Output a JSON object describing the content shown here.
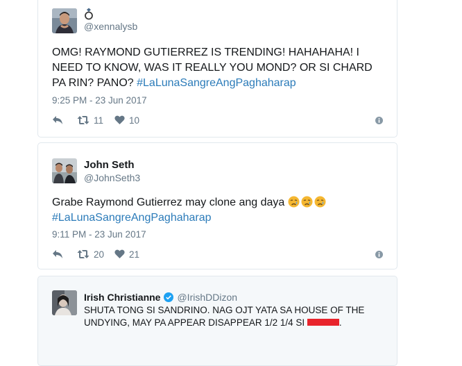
{
  "tweets": [
    {
      "display_name": "",
      "badge_icon": "ring-emoji-icon",
      "handle": "@xennalysb",
      "text": "OMG! RAYMOND GUTIERREZ IS TRENDING! HAHAHAHA! I NEED TO KNOW, WAS IT REALLY YOU MOND? OR SI CHARD PA RIN? PANO? ",
      "hashtag": "#LaLunaSangreAngPaghaharap",
      "timestamp": "9:25 PM - 23 Jun 2017",
      "retweets": "11",
      "likes": "10"
    },
    {
      "display_name": "John Seth",
      "handle": "@JohnSeth3",
      "text": "Grabe Raymond Gutierrez may clone ang daya ",
      "emojis": [
        "crying-face-emoji",
        "crying-face-emoji",
        "crying-face-emoji"
      ],
      "hashtag": "#LaLunaSangreAngPaghaharap",
      "timestamp": "9:11 PM - 23 Jun 2017",
      "retweets": "20",
      "likes": "21"
    },
    {
      "display_name": "Irish Christianne",
      "verified_icon": "verified-badge-icon",
      "handle": "@IrishDDizon",
      "text": "SHUTA TONG SI SANDRINO. NAG OJT YATA SA HOUSE OF THE UNDYING, MAY PA APPEAR DISAPPEAR 1/2 1/4 SI ",
      "text_end": ".",
      "redacted": true
    }
  ],
  "colors": {
    "text": "#14171a",
    "secondary": "#657786",
    "hashtag": "#2b7bb9",
    "border": "#e1e8ed",
    "verified": "#1da1f2",
    "redaction": "#e8242c",
    "quoted_bg": "#f5f8fa"
  }
}
